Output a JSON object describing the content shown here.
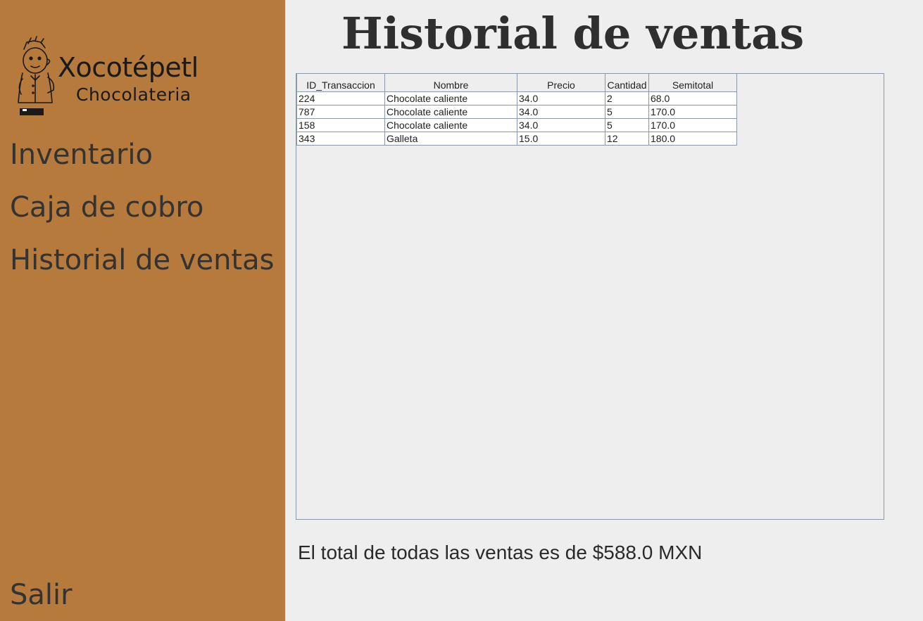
{
  "sidebar": {
    "logo": {
      "title": "Xocotépetl",
      "subtitle": "Chocolateria"
    },
    "items": [
      {
        "label": "Inventario"
      },
      {
        "label": "Caja de cobro"
      },
      {
        "label": "Historial de ventas"
      }
    ],
    "exit_label": "Salir",
    "background_color": "#b57a3c"
  },
  "main": {
    "title": "Historial de ventas",
    "table": {
      "columns": [
        "ID_Transaccion",
        "Nombre",
        "Precio",
        "Cantidad",
        "Semitotal"
      ],
      "rows": [
        [
          "224",
          "Chocolate caliente",
          "34.0",
          "2",
          "68.0"
        ],
        [
          "787",
          "Chocolate caliente",
          "34.0",
          "5",
          "170.0"
        ],
        [
          "158",
          "Chocolate caliente",
          "34.0",
          "5",
          "170.0"
        ],
        [
          "343",
          "Galleta",
          "15.0",
          "12",
          "180.0"
        ]
      ]
    },
    "total_text": "El total de todas las ventas es de $588.0 MXN"
  }
}
